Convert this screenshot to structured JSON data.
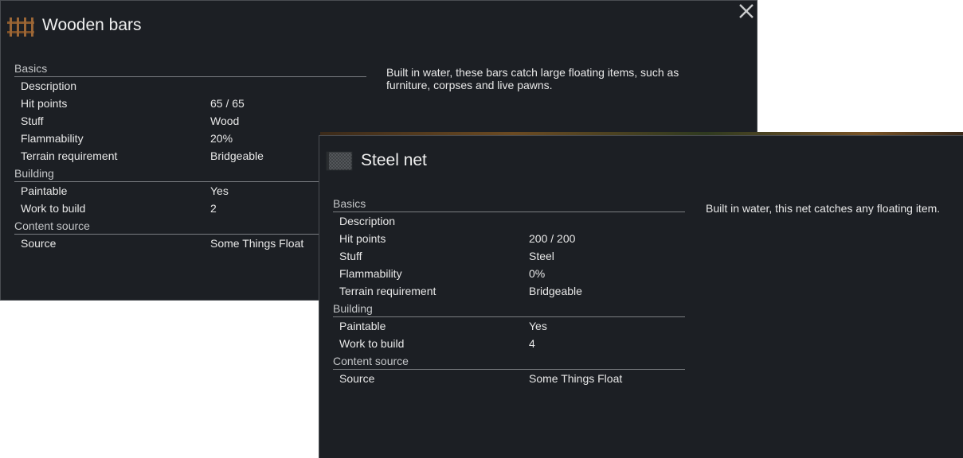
{
  "windows": [
    {
      "title": "Wooden bars",
      "thumbnail": "wooden-bars-icon",
      "description": "Built in water, these bars catch large floating items, such as furniture, corpses and live pawns.",
      "sections": [
        {
          "name": "Basics",
          "rows": [
            {
              "label": "Description",
              "value": ""
            },
            {
              "label": "Hit points",
              "value": "65 / 65"
            },
            {
              "label": "Stuff",
              "value": "Wood"
            },
            {
              "label": "Flammability",
              "value": "20%"
            },
            {
              "label": "Terrain requirement",
              "value": "Bridgeable"
            }
          ]
        },
        {
          "name": "Building",
          "rows": [
            {
              "label": "Paintable",
              "value": "Yes"
            },
            {
              "label": "Work to build",
              "value": "2"
            }
          ]
        },
        {
          "name": "Content source",
          "rows": [
            {
              "label": "Source",
              "value": "Some Things Float"
            }
          ]
        }
      ]
    },
    {
      "title": "Steel net",
      "thumbnail": "steel-net-icon",
      "description": "Built in water, this net catches any floating item.",
      "sections": [
        {
          "name": "Basics",
          "rows": [
            {
              "label": "Description",
              "value": ""
            },
            {
              "label": "Hit points",
              "value": "200 / 200"
            },
            {
              "label": "Stuff",
              "value": "Steel"
            },
            {
              "label": "Flammability",
              "value": "0%"
            },
            {
              "label": "Terrain requirement",
              "value": "Bridgeable"
            }
          ]
        },
        {
          "name": "Building",
          "rows": [
            {
              "label": "Paintable",
              "value": "Yes"
            },
            {
              "label": "Work to build",
              "value": "4"
            }
          ]
        },
        {
          "name": "Content source",
          "rows": [
            {
              "label": "Source",
              "value": "Some Things Float"
            }
          ]
        }
      ]
    }
  ],
  "icons": {
    "close": "close-icon"
  },
  "colors": {
    "panel_bg": "#1c1f24",
    "border": "#4a4d52",
    "text": "#e8e8e8",
    "category": "#c4c6c8"
  }
}
